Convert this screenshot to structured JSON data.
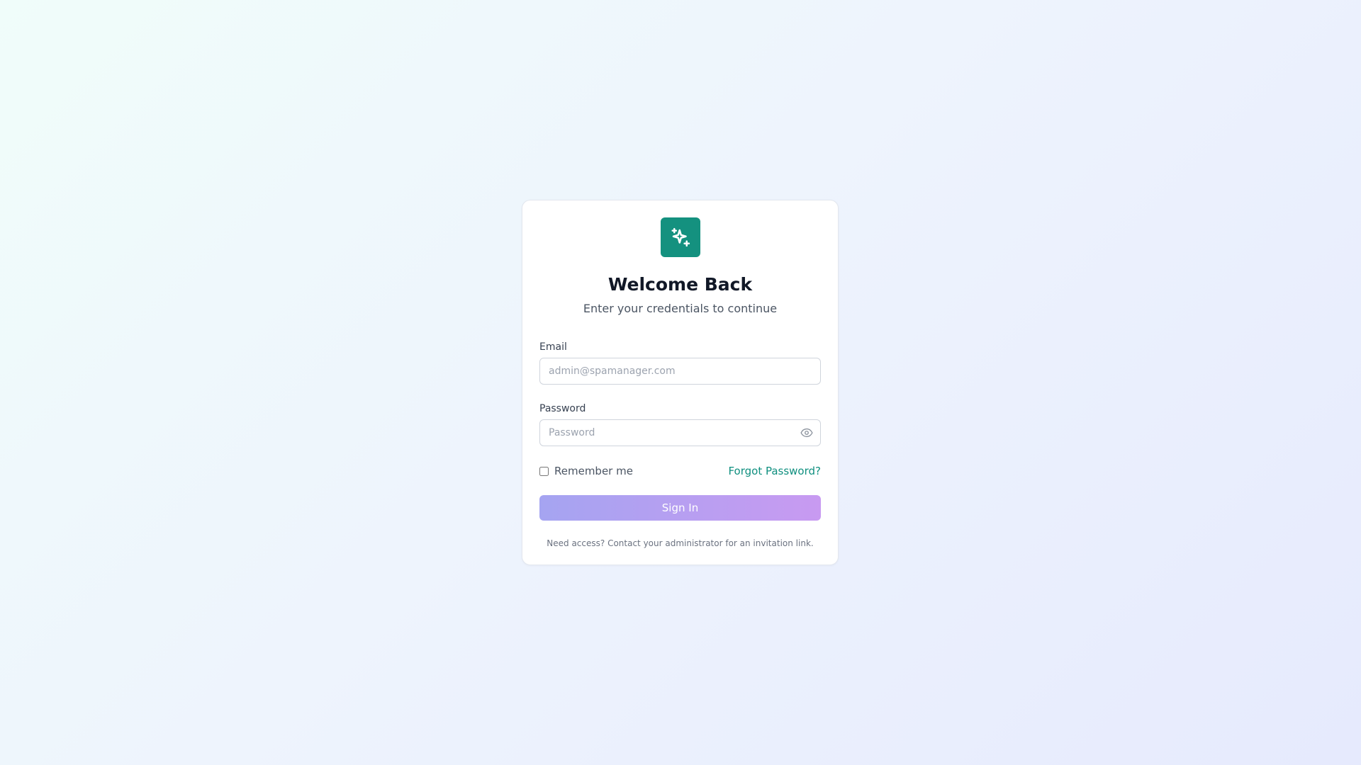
{
  "colors": {
    "brand": "#14917f",
    "link": "#0f8f7f",
    "button_gradient_start": "#a5a4f1",
    "button_gradient_end": "#c89af1"
  },
  "header": {
    "logo_icon": "sparkles-icon",
    "title": "Welcome Back",
    "subtitle": "Enter your credentials to continue"
  },
  "form": {
    "email": {
      "label": "Email",
      "value": "",
      "placeholder": "admin@spamanager.com"
    },
    "password": {
      "label": "Password",
      "value": "",
      "placeholder": "Password",
      "toggle_icon": "eye-icon"
    },
    "remember_me": {
      "label": "Remember me",
      "checked": false
    },
    "forgot_password_label": "Forgot Password?",
    "submit_label": "Sign In"
  },
  "footer": {
    "note": "Need access? Contact your administrator for an invitation link."
  }
}
